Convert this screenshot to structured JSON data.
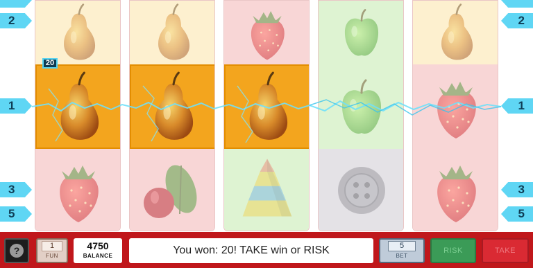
{
  "game": {
    "win_badge": "20",
    "paylines": {
      "left": [
        "2",
        "1",
        "3",
        "5"
      ],
      "right": [
        "2",
        "1",
        "3",
        "5"
      ]
    },
    "reels": [
      {
        "top": "pear-icon",
        "middle": "pear-icon",
        "bottom": "strawberry-icon"
      },
      {
        "top": "pear-icon",
        "middle": "pear-icon",
        "bottom": "cherry-leaf-icon"
      },
      {
        "top": "strawberry-icon",
        "middle": "pear-icon",
        "bottom": "pyramid-icon"
      },
      {
        "top": "apple-icon",
        "middle": "apple-icon",
        "bottom": "button-icon"
      },
      {
        "top": "pear-icon",
        "middle": "strawberry-icon",
        "bottom": "strawberry-icon"
      }
    ],
    "highlight_color": "#f3a51e",
    "payline_color": "#5fd6f4"
  },
  "bottom_bar": {
    "help_label": "?",
    "fun_value": "1",
    "fun_label": "FUN",
    "balance_value": "4750",
    "balance_label": "BALANCE",
    "message": "You won: 20! TAKE win or RISK",
    "bet_value": "5",
    "bet_label": "BET",
    "risk_label": "RISK",
    "take_label": "TAKE",
    "bar_color": "#c0171b"
  }
}
